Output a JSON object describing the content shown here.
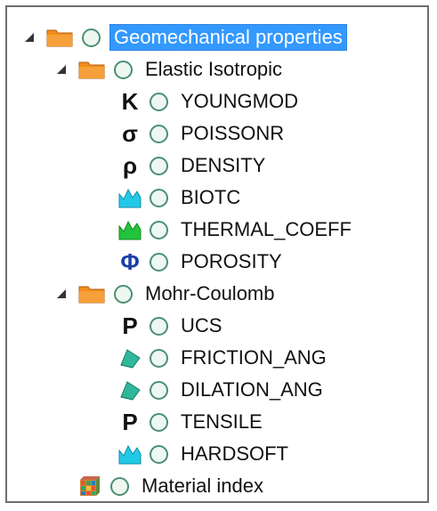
{
  "tree": {
    "root": {
      "label": "Geomechanical properties",
      "expanded": true,
      "selected": true,
      "children": [
        {
          "label": "Elastic Isotropic",
          "expanded": true,
          "children": [
            {
              "label": "YOUNGMOD",
              "symbol": "K",
              "icon": "kappa-symbol-icon"
            },
            {
              "label": "POISSONR",
              "symbol": "σ",
              "icon": "sigma-symbol-icon"
            },
            {
              "label": "DENSITY",
              "symbol": "ρ",
              "icon": "rho-symbol-icon"
            },
            {
              "label": "BIOTC",
              "symbol": "",
              "icon": "cyan-spike-icon"
            },
            {
              "label": "THERMAL_COEFF",
              "symbol": "",
              "icon": "green-spike-icon"
            },
            {
              "label": "POROSITY",
              "symbol": "Φ",
              "icon": "phi-symbol-icon"
            }
          ]
        },
        {
          "label": "Mohr-Coulomb",
          "expanded": true,
          "children": [
            {
              "label": "UCS",
              "symbol": "P",
              "icon": "p-symbol-icon"
            },
            {
              "label": "FRICTION_ANG",
              "symbol": "",
              "icon": "angle-wedge-icon"
            },
            {
              "label": "DILATION_ANG",
              "symbol": "",
              "icon": "angle-wedge-icon"
            },
            {
              "label": "TENSILE",
              "symbol": "P",
              "icon": "p-symbol-icon"
            },
            {
              "label": "HARDSOFT",
              "symbol": "",
              "icon": "cyan-spike-icon"
            }
          ]
        },
        {
          "label": "Material index",
          "icon": "material-grid-icon"
        }
      ]
    }
  },
  "colors": {
    "selection": "#3399ff",
    "folder": "#f28c1c",
    "circle": "#4b8f73",
    "cyan_icon": "#22c9e6",
    "green_icon": "#23c33c",
    "wedge_icon": "#2fb79a"
  }
}
